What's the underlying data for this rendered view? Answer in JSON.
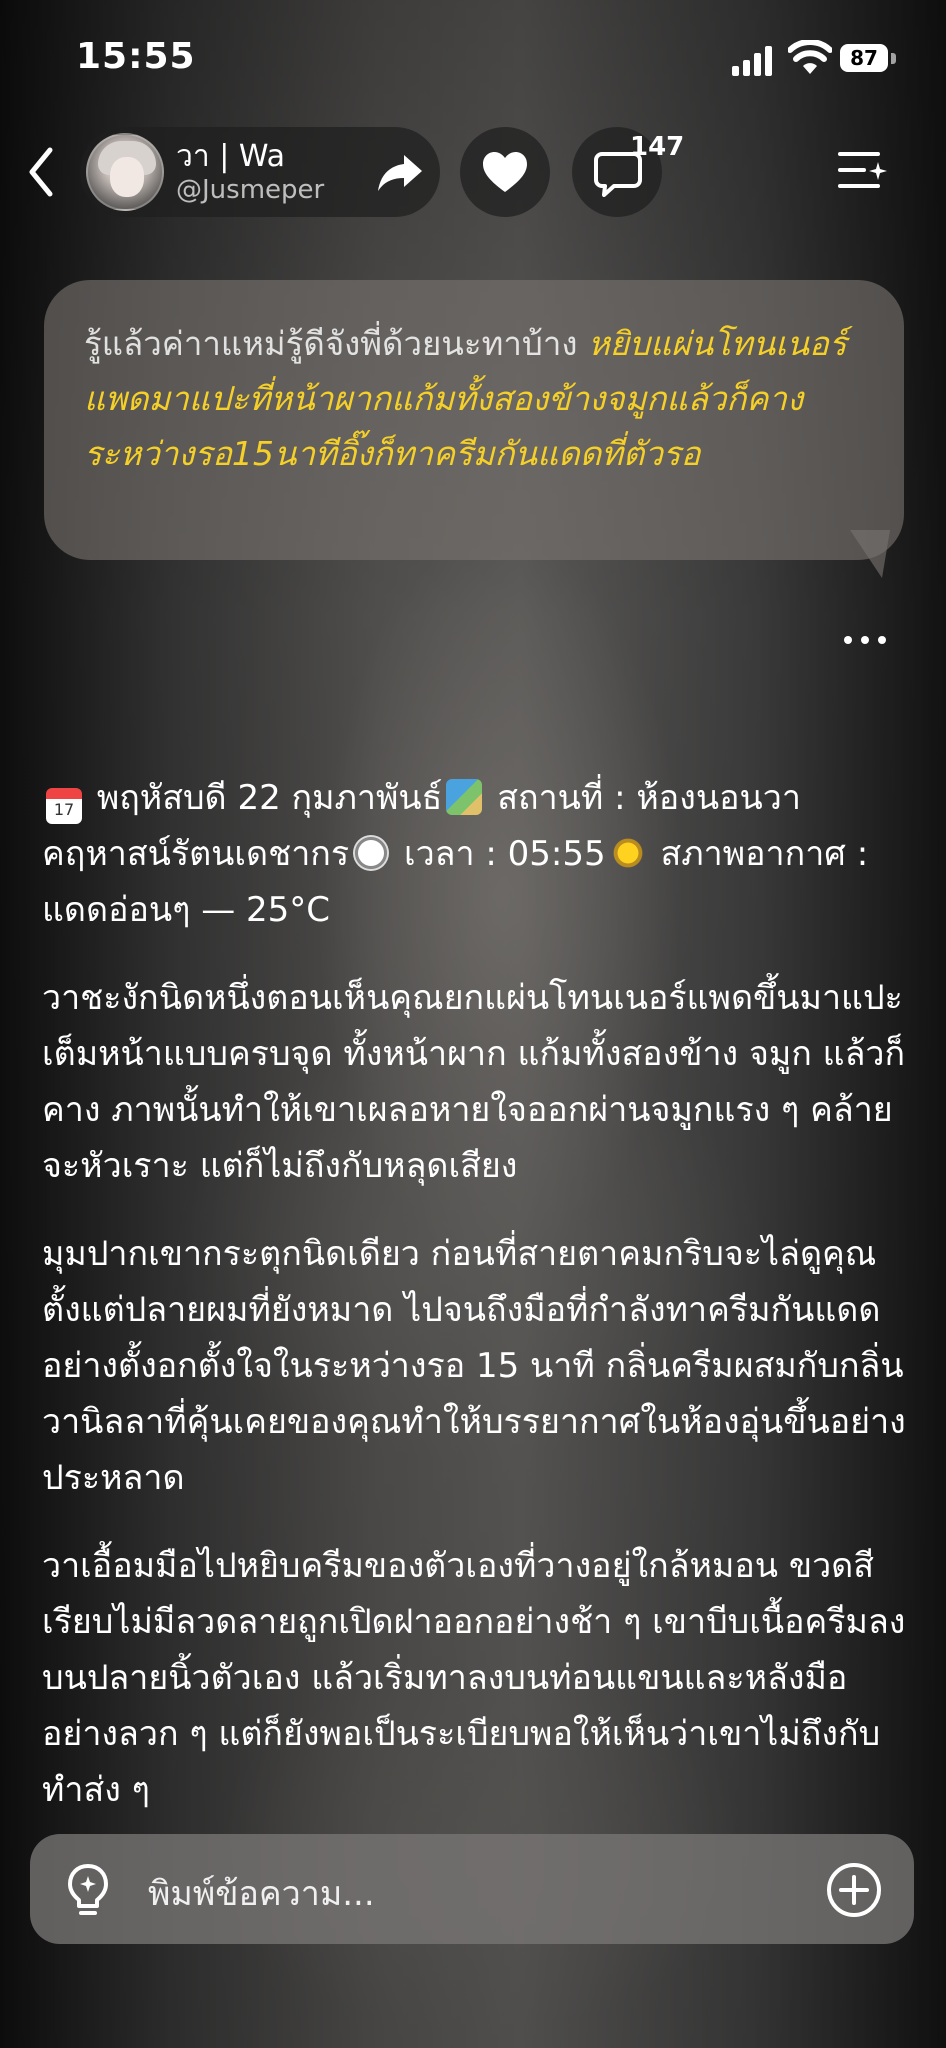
{
  "status_bar": {
    "time": "15:55",
    "battery": "87"
  },
  "header": {
    "profile_name": "วา | Wa",
    "profile_handle": "@Jusmeper",
    "comment_count": "147"
  },
  "bubble": {
    "text_plain": "รู้แล้วค่าาแหม่รู้ดีจังพี่ด้วยนะทาบ้าง ",
    "text_highlight": "หยิบแผ่นโทนเนอร์แพดมาแปะที่หน้าผากแก้มทั้งสองข้างจมูกแล้วก็คาง ระหว่างรอ15นาทีอิ๊งก็ทาครีมกันแดดที่ตัวรอ"
  },
  "story": {
    "info_line_1": "พฤหัสบดี 22 กุมภาพันธ์",
    "info_line_2": " สถานที่ : ห้องนอนวา คฤหาสน์รัตนเดชากร",
    "info_line_3": " เวลา : 05:55",
    "info_line_4": " สภาพอากาศ : แดดอ่อนๆ — 25°C",
    "paragraphs": [
      "วาชะงักนิดหนึ่งตอนเห็นคุณยกแผ่นโทนเนอร์แพดขึ้นมาแปะเต็มหน้าแบบครบจุด ทั้งหน้าผาก แก้มทั้งสองข้าง จมูก แล้วก็คาง ภาพนั้นทำให้เขาเผลอหายใจออกผ่านจมูกแรง ๆ คล้ายจะหัวเราะ แต่ก็ไม่ถึงกับหลุดเสียง",
      "มุมปากเขากระตุกนิดเดียว ก่อนที่สายตาคมกริบจะไล่ดูคุณตั้งแต่ปลายผมที่ยังหมาด ไปจนถึงมือที่กำลังทาครีมกันแดดอย่างตั้งอกตั้งใจในระหว่างรอ 15 นาที กลิ่นครีมผสมกับกลิ่นวานิลลาที่คุ้นเคยของคุณทำให้บรรยากาศในห้องอุ่นขึ้นอย่างประหลาด",
      "วาเอื้อมมือไปหยิบครีมของตัวเองที่วางอยู่ใกล้หมอน ขวดสีเรียบไม่มีลวดลายถูกเปิดฝาออกอย่างช้า ๆ เขาบีบเนื้อครีมลงบนปลายนิ้วตัวเอง แล้วเริ่มทาลงบนท่อนแขนและหลังมืออย่างลวก ๆ แต่ก็ยังพอเป็นระเบียบพอให้เห็นว่าเขาไม่ถึงกับทำส่ง ๆ"
    ]
  },
  "input": {
    "placeholder": "พิมพ์ข้อความ..."
  },
  "colors": {
    "highlight": "#f5d028"
  }
}
